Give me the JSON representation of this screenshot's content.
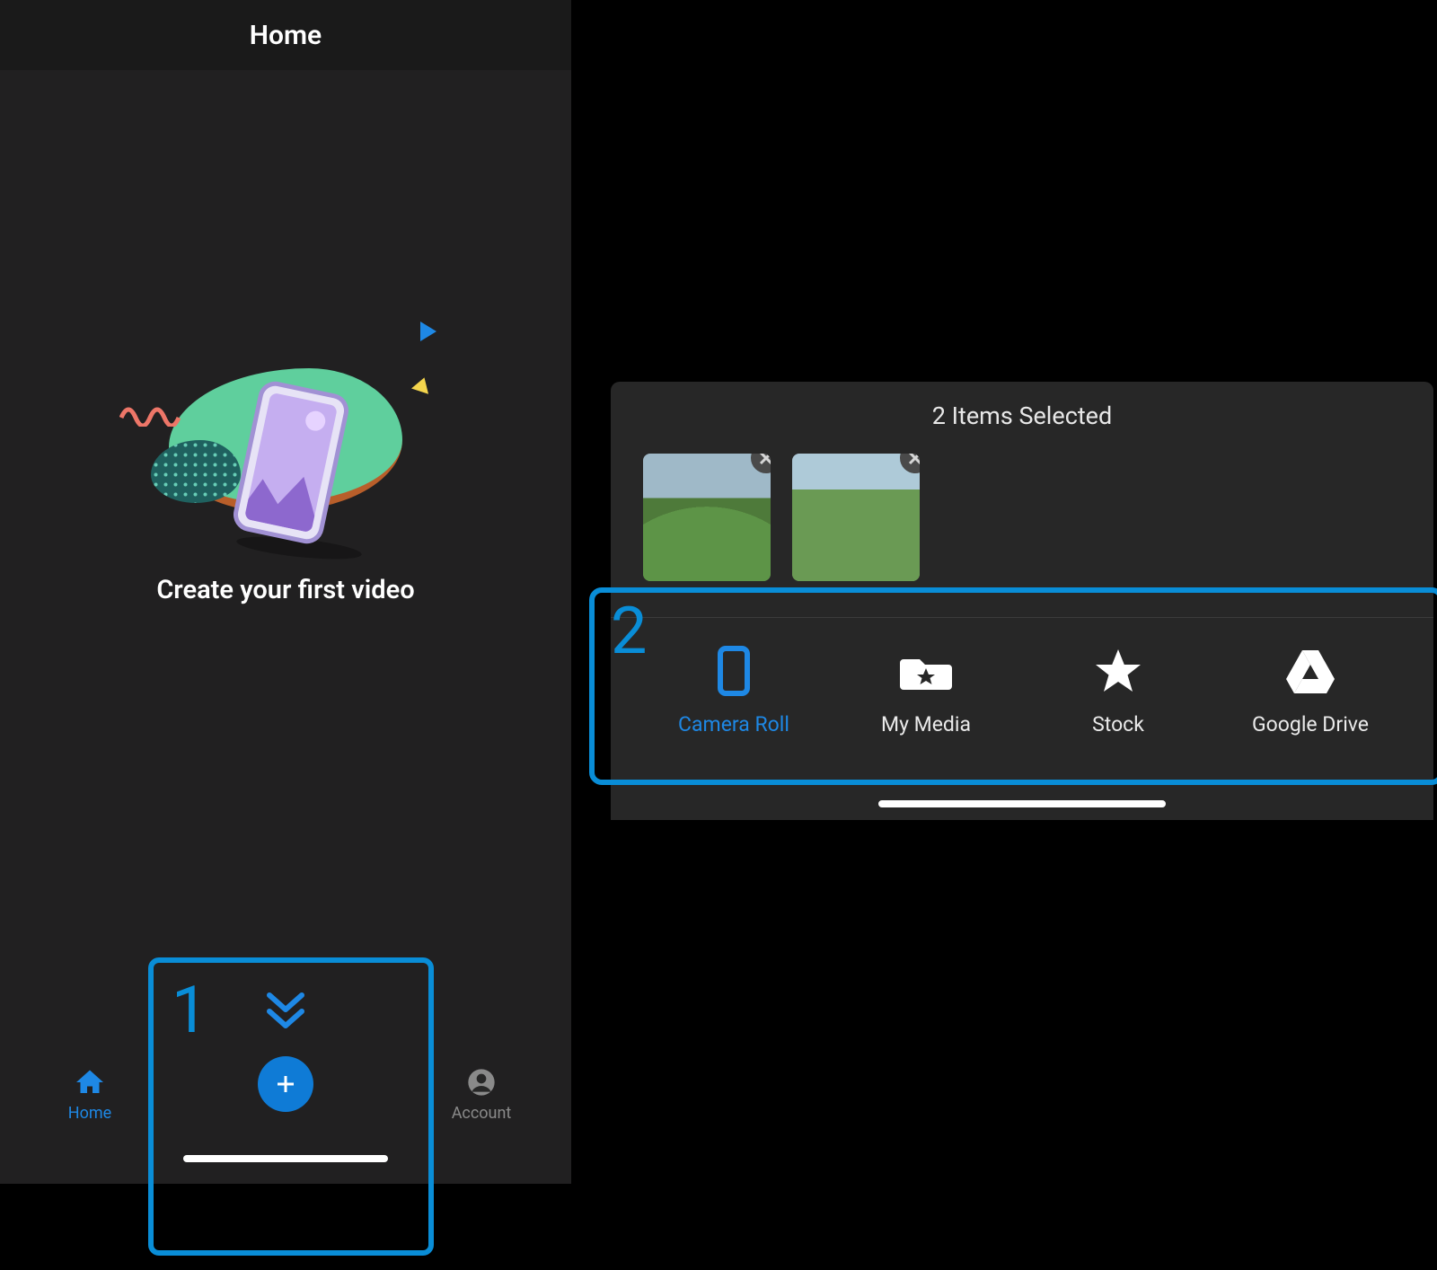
{
  "left": {
    "header_title": "Home",
    "empty_message": "Create your first video",
    "nav": {
      "home_label": "Home",
      "account_label": "Account"
    }
  },
  "right": {
    "sheet_title": "2 Items Selected",
    "thumbs": [
      {
        "name": "selected-item-1"
      },
      {
        "name": "selected-item-2"
      }
    ],
    "tabs": [
      {
        "label": "Camera Roll",
        "icon": "phone-icon",
        "selected": true
      },
      {
        "label": "My Media",
        "icon": "folder-star-icon",
        "selected": false
      },
      {
        "label": "Stock",
        "icon": "star-icon",
        "selected": false
      },
      {
        "label": "Google Drive",
        "icon": "drive-icon",
        "selected": false
      }
    ]
  },
  "callouts": {
    "num1": "1",
    "num2": "2"
  },
  "colors": {
    "accent": "#1e88e5",
    "callout_border": "#098dd7"
  }
}
